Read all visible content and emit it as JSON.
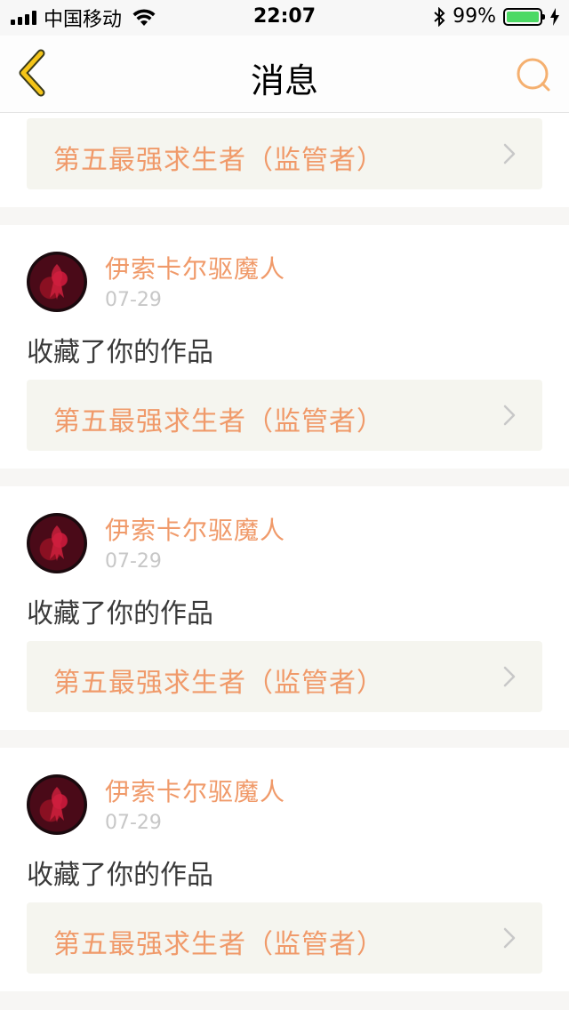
{
  "status_bar": {
    "carrier": "中国移动",
    "time": "22:07",
    "battery_percent": "99%",
    "battery_level": 0.99,
    "battery_color": "#4cd964"
  },
  "nav": {
    "title": "消息",
    "back_icon": "chevron-left-icon",
    "search_icon": "search-icon",
    "accent_color": "#f5c518"
  },
  "messages": [
    {
      "username": "伊索卡尔驱魔人",
      "date": "07-29",
      "action": "收藏了你的作品",
      "work_title": "第五最强求生者（监管者）"
    },
    {
      "username": "伊索卡尔驱魔人",
      "date": "07-29",
      "action": "收藏了你的作品",
      "work_title": "第五最强求生者（监管者）"
    },
    {
      "username": "伊索卡尔驱魔人",
      "date": "07-29",
      "action": "收藏了你的作品",
      "work_title": "第五最强求生者（监管者）"
    },
    {
      "username": "伊索卡尔驱魔人",
      "date": "07-29",
      "action": "收藏了你的作品",
      "work_title": "第五最强求生者（监管者）"
    }
  ],
  "colors": {
    "username": "#f09a6a",
    "date": "#c7c7c7",
    "work_bg": "#f5f5ef"
  }
}
